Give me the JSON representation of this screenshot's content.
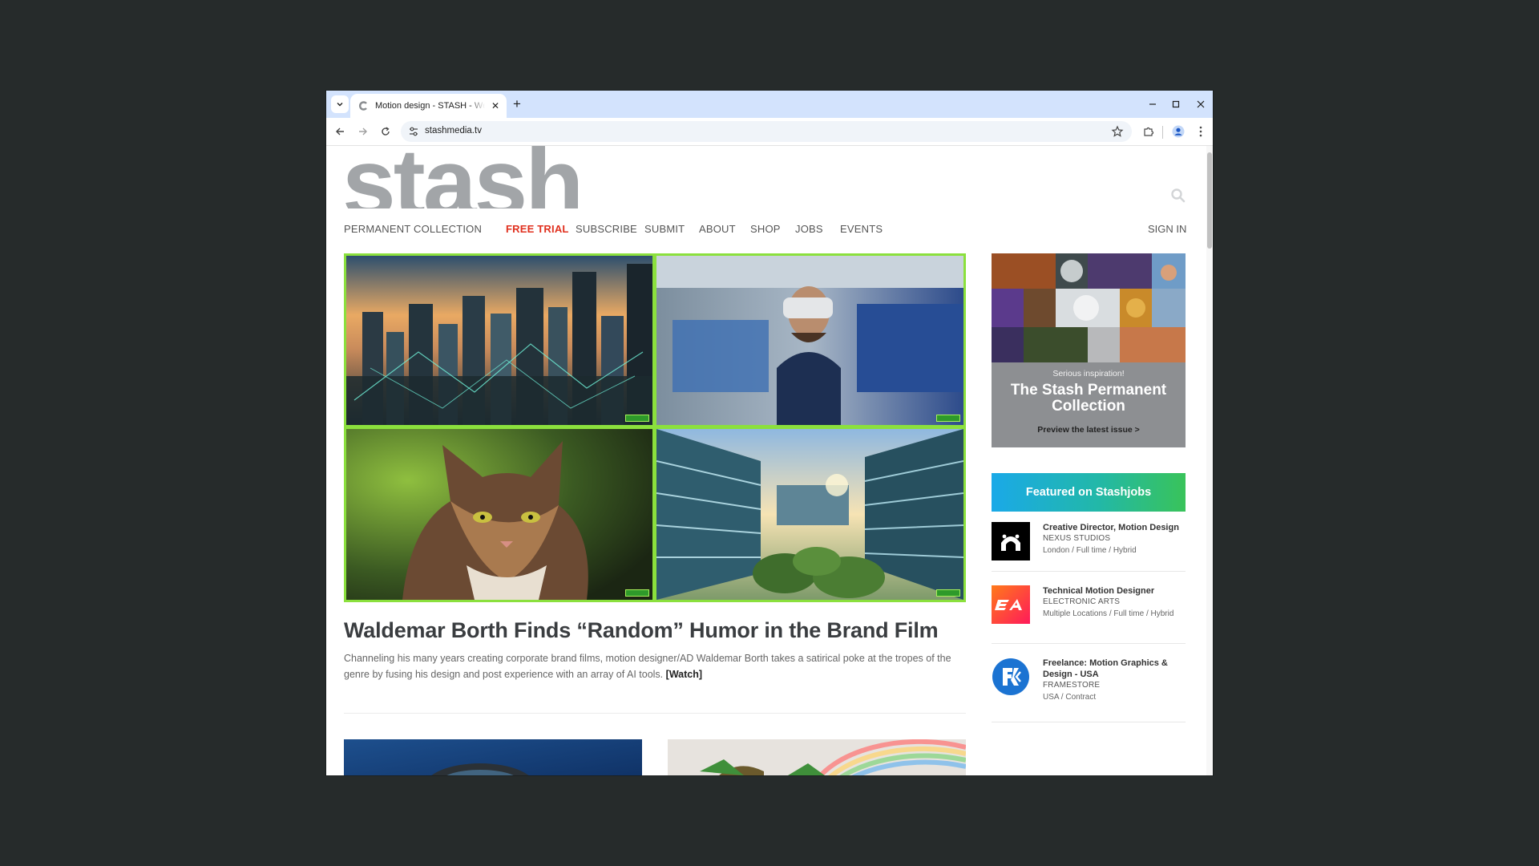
{
  "browser": {
    "tab_title": "Motion design - STASH - Welcome",
    "url": "stashmedia.tv"
  },
  "site": {
    "logo_text": "stash",
    "nav": [
      {
        "label": "PERMANENT COLLECTION"
      },
      {
        "label": "FREE TRIAL"
      },
      {
        "label": "SUBSCRIBE"
      },
      {
        "label": "SUBMIT"
      },
      {
        "label": "ABOUT"
      },
      {
        "label": "SHOP"
      },
      {
        "label": "JOBS"
      },
      {
        "label": "EVENTS"
      }
    ],
    "sign_in": "SIGN IN"
  },
  "article": {
    "title": "Waldemar Borth Finds “Random” Humor in the Brand Film",
    "body": "Channeling his many years creating corporate brand films, motion designer/AD Waldemar Borth takes a satirical poke at the tropes of the genre by fusing his design and post experience with an array of AI tools.",
    "watch_label": "[Watch]"
  },
  "promo": {
    "kicker": "Serious inspiration!",
    "title": "The Stash Permanent Collection",
    "link": "Preview the latest issue >"
  },
  "jobs": {
    "banner": "Featured on Stashjobs",
    "items": [
      {
        "title": "Creative Director, Motion Design",
        "company": "NEXUS STUDIOS",
        "meta": "London / Full time / Hybrid"
      },
      {
        "title": "Technical Motion Designer",
        "company": "ELECTRONIC ARTS",
        "meta": "Multiple Locations / Full time / Hybrid"
      },
      {
        "title": "Freelance: Motion Graphics & Design - USA",
        "company": "FRAMESTORE",
        "meta": "USA / Contract"
      }
    ]
  },
  "colors": {
    "free_trial": "#e0301e",
    "hero_border": "#8be03d",
    "jobs_banner_start": "#1aa9e8",
    "jobs_banner_end": "#39c35a",
    "browser_frame": "#d3e3fd"
  }
}
